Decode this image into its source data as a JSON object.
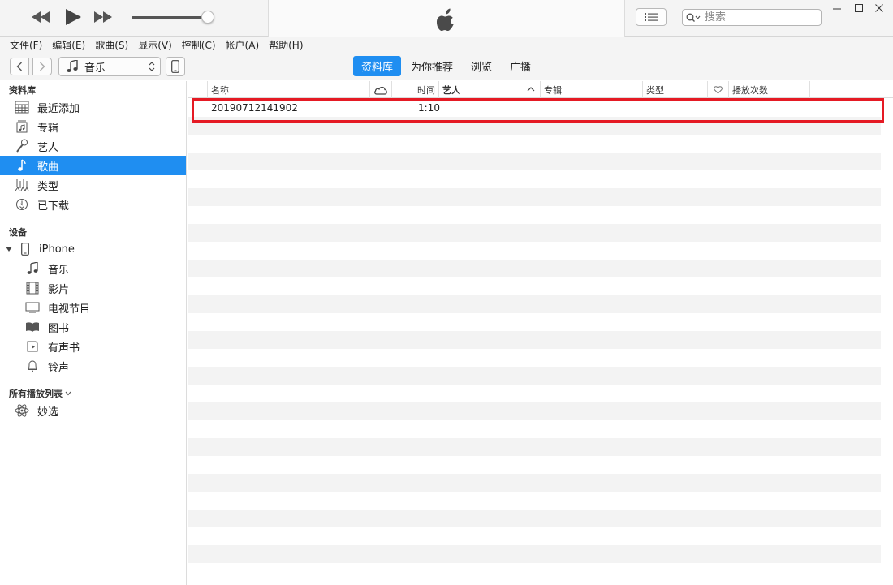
{
  "window": {
    "search_placeholder": "搜索"
  },
  "menu": [
    "文件(F)",
    "编辑(E)",
    "歌曲(S)",
    "显示(V)",
    "控制(C)",
    "帐户(A)",
    "帮助(H)"
  ],
  "nav": {
    "media_type": "音乐",
    "tabs": [
      {
        "label": "资料库",
        "active": true
      },
      {
        "label": "为你推荐",
        "active": false
      },
      {
        "label": "浏览",
        "active": false
      },
      {
        "label": "广播",
        "active": false
      }
    ]
  },
  "sidebar": {
    "library_header": "资料库",
    "library_items": [
      {
        "label": "最近添加",
        "icon": "grid-icon"
      },
      {
        "label": "专辑",
        "icon": "album-icon"
      },
      {
        "label": "艺人",
        "icon": "microphone-icon"
      },
      {
        "label": "歌曲",
        "icon": "music-note-icon",
        "selected": true
      },
      {
        "label": "类型",
        "icon": "genre-icon"
      },
      {
        "label": "已下载",
        "icon": "download-clock-icon"
      }
    ],
    "devices_header": "设备",
    "device_name": "iPhone",
    "device_items": [
      {
        "label": "音乐",
        "icon": "music-note-icon"
      },
      {
        "label": "影片",
        "icon": "film-icon"
      },
      {
        "label": "电视节目",
        "icon": "tv-icon"
      },
      {
        "label": "图书",
        "icon": "book-icon"
      },
      {
        "label": "有声书",
        "icon": "audiobook-icon"
      },
      {
        "label": "铃声",
        "icon": "bell-icon"
      }
    ],
    "playlists_header": "所有播放列表",
    "playlist_items": [
      {
        "label": "妙选",
        "icon": "genius-atom-icon"
      }
    ]
  },
  "songs": {
    "columns": {
      "name": "名称",
      "time": "时间",
      "artist": "艺人",
      "album": "专辑",
      "genre": "类型",
      "plays": "播放次数"
    },
    "rows": [
      {
        "name": "20190712141902",
        "time": "1:10",
        "artist": "",
        "album": "",
        "genre": "",
        "plays": ""
      }
    ]
  },
  "colors": {
    "accent": "#1f8ef1",
    "highlight_box": "#e51a24",
    "stripe": "#f3f3f3"
  }
}
